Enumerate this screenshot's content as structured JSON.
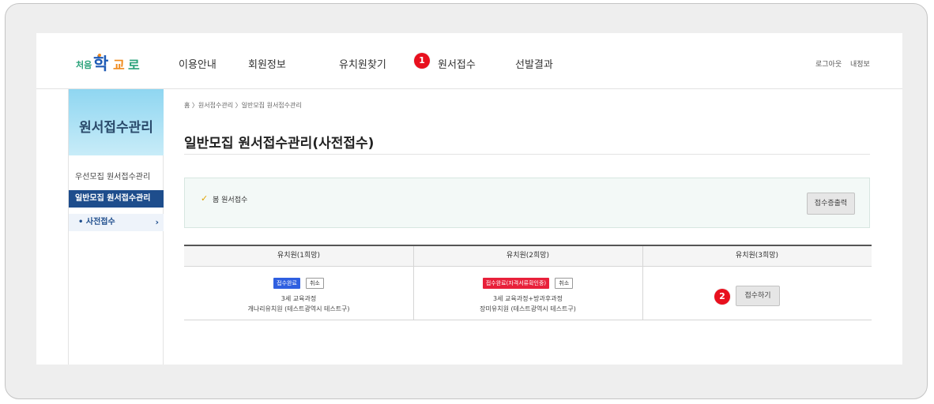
{
  "header": {
    "logo_alt": "처음학교로",
    "nav": [
      {
        "label": "이용안내"
      },
      {
        "label": "회원정보"
      },
      {
        "label": "유치원찾기"
      },
      {
        "label": "원서접수",
        "badge": "1"
      },
      {
        "label": "선발결과"
      }
    ],
    "logout": "로그아웃",
    "myinfo": "내정보"
  },
  "sidebar": {
    "title": "원서접수관리",
    "items": [
      {
        "label": "우선모집 원서접수관리"
      },
      {
        "label": "일반모집 원서접수관리"
      },
      {
        "label": "• 사전접수",
        "arrow": "›"
      }
    ]
  },
  "breadcrumb": "홈 〉원서접수관리 〉일반모집 원서접수관리",
  "page_title": "일반모집 원서접수관리(사전접수)",
  "notice": {
    "check_icon": "✓",
    "label": "봄 원서접수",
    "print_button": "접수증출력"
  },
  "table": {
    "headers": [
      "유치원(1희망)",
      "유치원(2희망)",
      "유치원(3희망)"
    ],
    "cells": [
      {
        "status": "접수완료",
        "status_color": "#2f5fe0",
        "cancel": "취소",
        "course": "3세 교육과정",
        "kindergarten": "개나리유치원 (테스트광역시 테스트구)"
      },
      {
        "status": "접수완료(자격서류확인중)",
        "status_color": "#e8203a",
        "cancel": "취소",
        "course": "3세 교육과정+방과후과정",
        "kindergarten": "장미유치원 (테스트광역시 테스트구)"
      },
      {
        "badge": "2",
        "apply_button": "접수하기"
      }
    ]
  },
  "colors": {
    "accent_red": "#e8101e",
    "sidebar_active": "#1e4d8c"
  }
}
